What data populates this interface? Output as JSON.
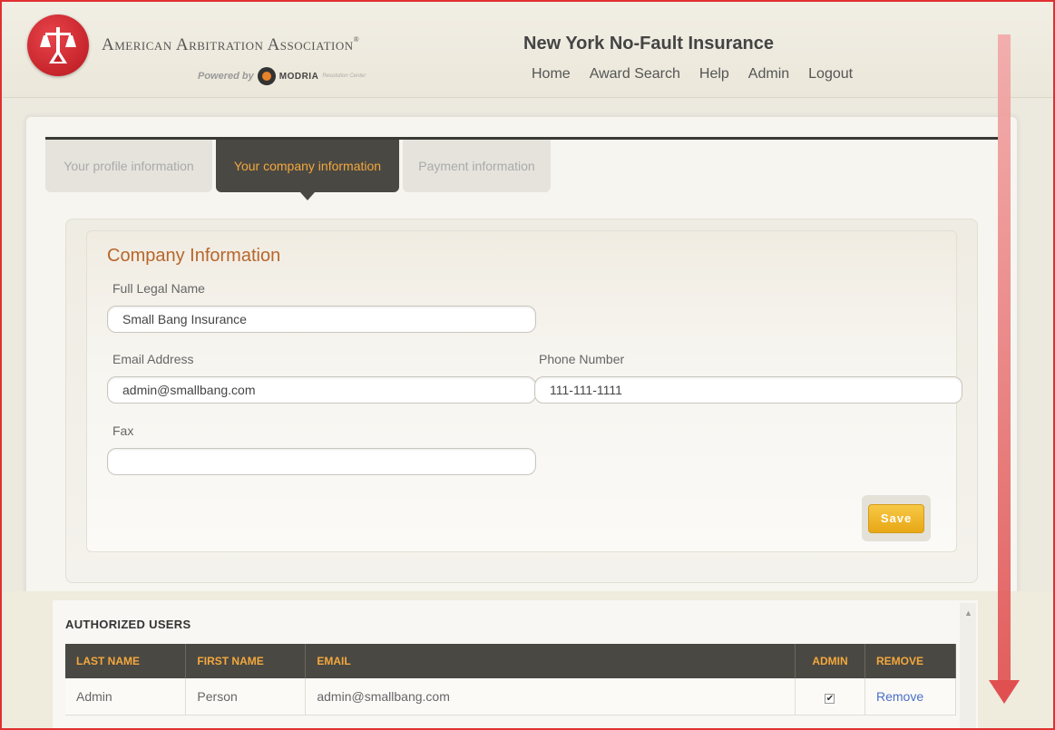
{
  "header": {
    "org_name": "American Arbitration Association",
    "org_mark": "®",
    "powered_by": "Powered by",
    "modria_name": "MODRIA",
    "modria_sub": "Resolution Center",
    "site_title": "New York No-Fault Insurance",
    "nav": [
      "Home",
      "Award Search",
      "Help",
      "Admin",
      "Logout"
    ]
  },
  "tabs": [
    {
      "label": "Your profile information",
      "active": false
    },
    {
      "label": "Your company information",
      "active": true
    },
    {
      "label": "Payment information",
      "active": false
    }
  ],
  "company": {
    "section_title": "Company Information",
    "full_legal_name_label": "Full Legal Name",
    "full_legal_name_value": "Small Bang Insurance",
    "email_label": "Email Address",
    "email_value": "admin@smallbang.com",
    "phone_label": "Phone Number",
    "phone_value": "111-111-1111",
    "fax_label": "Fax",
    "fax_value": "",
    "save_label": "Save"
  },
  "users": {
    "title": "AUTHORIZED USERS",
    "columns": [
      "LAST NAME",
      "FIRST NAME",
      "EMAIL",
      "ADMIN",
      "REMOVE"
    ],
    "rows": [
      {
        "last_name": "Admin",
        "first_name": "Person",
        "email": "admin@smallbang.com",
        "admin": "✔",
        "remove": "Remove"
      }
    ]
  },
  "colors": {
    "accent_orange": "#f3a83e",
    "tab_dark": "#4a4842",
    "title_brown": "#b7662c",
    "save_yellow": "#f2b92e",
    "link_blue": "#4a6fc8",
    "annotation_red": "#e05050"
  },
  "icons": {
    "logo": "scales-of-justice-icon",
    "modria": "modria-logo-icon",
    "annotation": "scroll-down-arrow-icon",
    "scroll": "scroll-up-caret-icon"
  }
}
